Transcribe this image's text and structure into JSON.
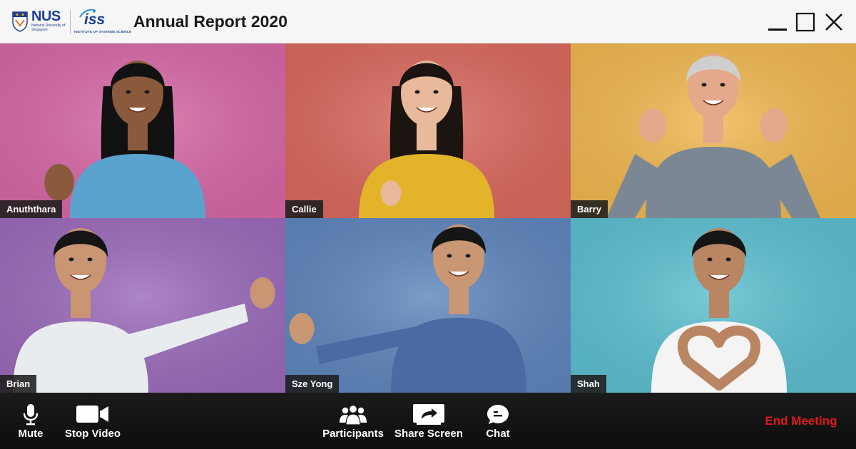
{
  "window": {
    "title": "Annual Report 2020",
    "logos": {
      "nus": {
        "word": "NUS",
        "subtitle": "National University of Singapore"
      },
      "iss": {
        "word": "iss",
        "subtitle": "INSTITUTE OF SYSTEMS SCIENCE"
      }
    },
    "controls": [
      "minimize-icon",
      "maximize-icon",
      "close-icon"
    ]
  },
  "participants": [
    {
      "name": "Anuththara",
      "bg": "#d668a6",
      "shirt": "#5aa3cf",
      "hair": "#111111",
      "skin": "#8b5a3c"
    },
    {
      "name": "Callie",
      "bg": "#d9695e",
      "shirt": "#e3b32a",
      "hair": "#1b1411",
      "skin": "#e8b99a"
    },
    {
      "name": "Barry",
      "bg": "#f0b750",
      "shirt": "#7b8794",
      "hair": "#cfcfcf",
      "skin": "#e3a98a"
    },
    {
      "name": "Brian",
      "bg": "#9b6bbb",
      "shirt": "#e9ecef",
      "hair": "#151515",
      "skin": "#c99572"
    },
    {
      "name": "Sze Yong",
      "bg": "#5f86bd",
      "shirt": "#4a6aa3",
      "hair": "#151515",
      "skin": "#c99773"
    },
    {
      "name": "Shah",
      "bg": "#5dbfd0",
      "shirt": "#f4f4f4",
      "hair": "#151515",
      "skin": "#b98562"
    }
  ],
  "toolbar": {
    "mute": {
      "label": "Mute",
      "icon": "microphone-icon"
    },
    "stop_video": {
      "label": "Stop Video",
      "icon": "video-camera-icon"
    },
    "participants": {
      "label": "Participants",
      "icon": "participants-icon"
    },
    "share_screen": {
      "label": "Share Screen",
      "icon": "share-screen-icon"
    },
    "chat": {
      "label": "Chat",
      "icon": "chat-bubble-icon"
    },
    "end_meeting": {
      "label": "End Meeting",
      "color": "#e01b1b"
    }
  }
}
